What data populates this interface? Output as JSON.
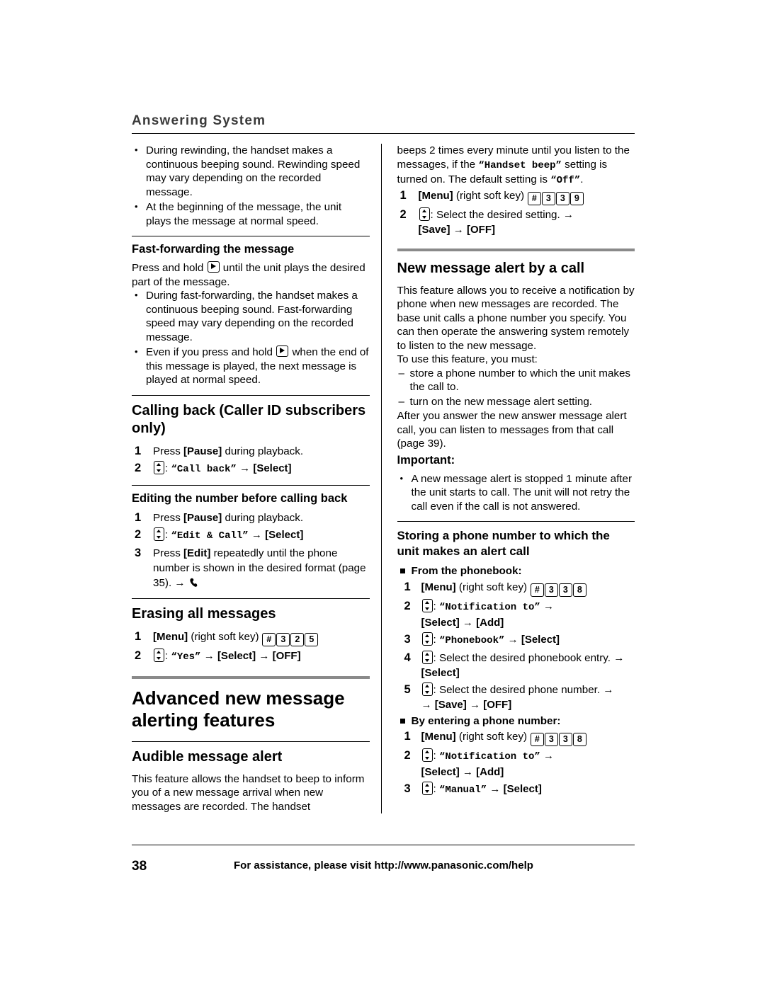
{
  "header": {
    "title": "Answering System"
  },
  "left": {
    "bullets_top": [
      "During rewinding, the handset makes a continuous beeping sound. Rewinding speed may vary depending on the recorded message.",
      "At the beginning of the message, the unit plays the message at normal speed."
    ],
    "fastforward": {
      "heading": "Fast-forwarding the message",
      "intro_pre": "Press and hold ",
      "intro_post": " until the unit plays the desired part of the message.",
      "bullets": [
        "During fast-forwarding, the handset makes a continuous beeping sound. Fast-forwarding speed may vary depending on the recorded message.",
        "Even if you press and hold  when the end of this message is played, the next message is played at normal speed."
      ],
      "bullet2_a": "Even if you press and hold ",
      "bullet2_b": " when the end of this message is played, the next message is played at normal speed."
    },
    "calling_back": {
      "heading": "Calling back (Caller ID subscribers only)",
      "step1_pre": "Press ",
      "step1_key": "[Pause]",
      "step1_post": " during playback.",
      "step2_label": "“Call back”",
      "step2_select": "[Select]"
    },
    "editing": {
      "heading": "Editing the number before calling back",
      "step1_pre": "Press ",
      "step1_key": "[Pause]",
      "step1_post": " during playback.",
      "step2_label": "“Edit & Call”",
      "step2_select": "[Select]",
      "step3_pre": "Press ",
      "step3_key": "[Edit]",
      "step3_post": " repeatedly until the phone number is shown in the desired format (page 35). →"
    },
    "erasing": {
      "heading": "Erasing all messages",
      "step1_menu": "[Menu]",
      "step1_soft": "(right soft key)",
      "step1_codes": [
        "#",
        "3",
        "2",
        "5"
      ],
      "step2_label": "“Yes”",
      "step2_select": "[Select]",
      "step2_off": "[OFF]"
    },
    "advanced": {
      "title": "Advanced new message alerting features",
      "audible": {
        "heading": "Audible message alert",
        "body": "This feature allows the handset to beep to inform you of a new message arrival when new messages are recorded. The handset"
      }
    }
  },
  "right": {
    "continued": {
      "part1": "beeps 2 times every minute until you listen to the messages, if the ",
      "handset_beep": "“Handset beep”",
      "part2": " setting is turned on. The default setting is ",
      "off_value": "“Off”",
      "part3": ".",
      "step1_menu": "[Menu]",
      "step1_soft": "(right soft key)",
      "step1_codes": [
        "#",
        "3",
        "3",
        "9"
      ],
      "step2_text": "Select the desired setting. →",
      "step2_save": "[Save]",
      "step2_off": "[OFF]"
    },
    "new_message_alert": {
      "heading": "New message alert by a call",
      "body": "This feature allows you to receive a notification by phone when new messages are recorded. The base unit calls a phone number you specify. You can then operate the answering system remotely to listen to the new message.",
      "use_intro": "To use this feature, you must:",
      "dashes": [
        "store a phone number to which the unit makes the call to.",
        "turn on the new message alert setting."
      ],
      "after": "After you answer the new answer message alert call, you can listen to messages from that call (page 39).",
      "important_label": "Important:",
      "important_bullets": [
        "A new message alert is stopped 1 minute after the unit starts to call. The unit will not retry the call even if the call is not answered."
      ]
    },
    "storing": {
      "heading": "Storing a phone number to which the unit makes an alert call",
      "from_phonebook_label": "From the phonebook:",
      "pb_step1_menu": "[Menu]",
      "pb_step1_soft": "(right soft key)",
      "pb_step1_codes": [
        "#",
        "3",
        "3",
        "8"
      ],
      "pb_step2_label": "“Notification to”",
      "pb_step2_select": "[Select]",
      "pb_step2_add": "[Add]",
      "pb_step3_label": "“Phonebook”",
      "pb_step3_select": "[Select]",
      "pb_step4_text": "Select the desired phonebook entry. →",
      "pb_step4_select": "[Select]",
      "pb_step5_text": "Select the desired phone number. →",
      "pb_step5_save": "[Save]",
      "pb_step5_off": "[OFF]",
      "by_entering_label": "By entering a phone number:",
      "en_step1_menu": "[Menu]",
      "en_step1_soft": "(right soft key)",
      "en_step1_codes": [
        "#",
        "3",
        "3",
        "8"
      ],
      "en_step2_label": "“Notification to”",
      "en_step2_select": "[Select]",
      "en_step2_add": "[Add]",
      "en_step3_label": "“Manual”",
      "en_step3_select": "[Select]"
    }
  },
  "footer": {
    "page_number": "38",
    "text": "For assistance, please visit http://www.panasonic.com/help"
  }
}
